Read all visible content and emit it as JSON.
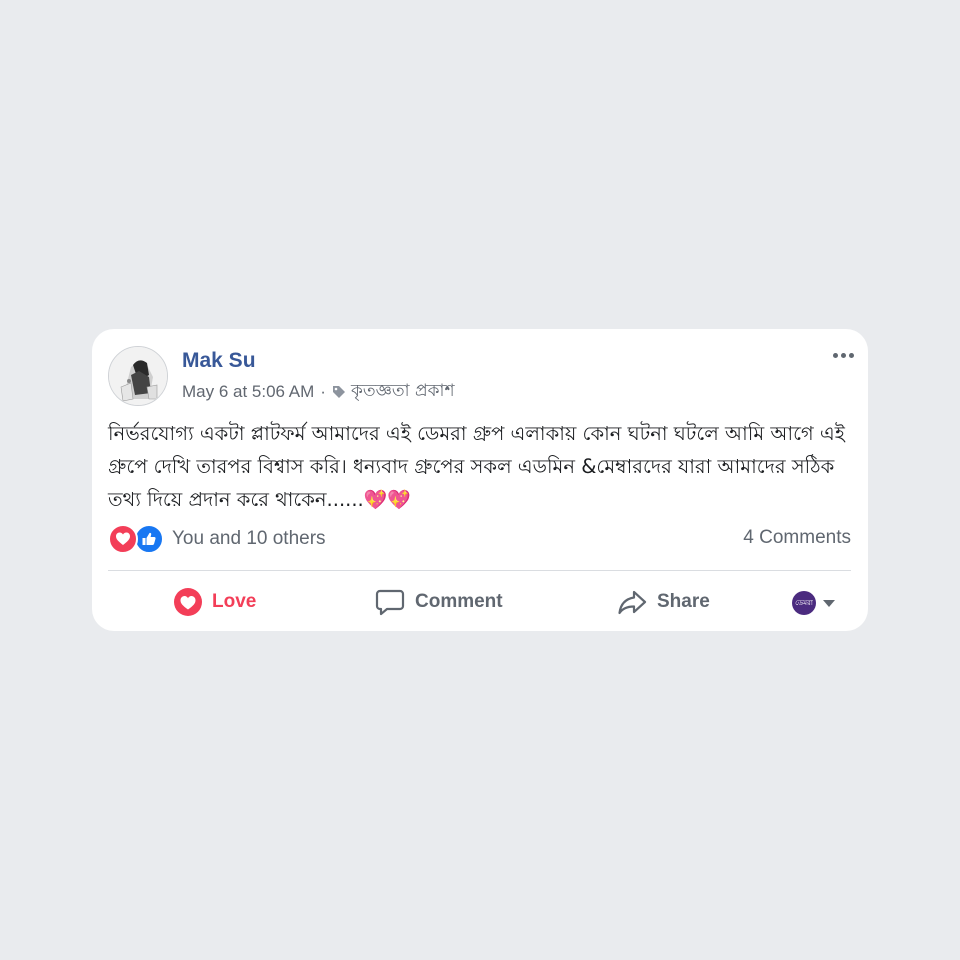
{
  "post": {
    "author": "Mak Su",
    "timestamp": "May 6 at 5:06 AM",
    "separator": "·",
    "topic": "কৃতজ্ঞতা প্রকাশ",
    "text": "নির্ভরযোগ্য একটা প্লাটফর্ম আমাদের এই ডেমরা গ্রুপ এলাকায় কোন ঘটনা ঘটলে আমি আগে এই গ্রুপে দেখি তারপর বিশ্বাস করি। ধন্যবাদ গ্রুপের সকল এডমিন &মেম্বারদের যারা আমাদের সঠিক তথ্য দিয়ে প্রদান করে থাকেন......",
    "emoji": "💖💖"
  },
  "reactions": {
    "text": "You and 10 others",
    "icons": [
      "love-icon",
      "like-icon"
    ]
  },
  "comments_count": "4 Comments",
  "actions": {
    "love_label": "Love",
    "comment_label": "Comment",
    "share_label": "Share"
  },
  "page_selector": {
    "avatar_text": "ডেমরা"
  },
  "colors": {
    "background": "#e9ebee",
    "author": "#385898",
    "love": "#f33e58",
    "like": "#1877f2",
    "secondary_text": "#606770"
  }
}
